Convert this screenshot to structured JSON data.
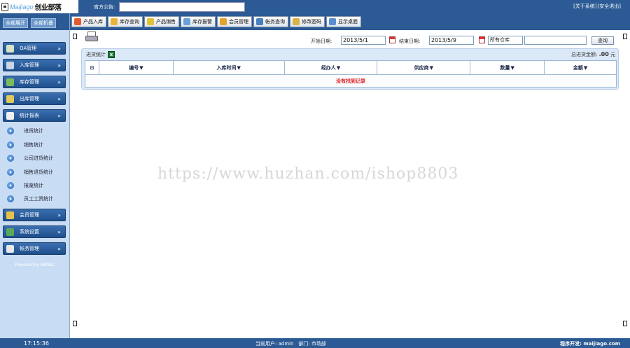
{
  "header": {
    "logo_latin": "Maijiago",
    "logo_cn": "创业部落",
    "notice_label": "官方公告:",
    "links": [
      "[关于系统]",
      "[安全退出]"
    ]
  },
  "toolbar": {
    "buttons": [
      {
        "label": "产品入库",
        "icon": "import-icon",
        "color": "#e25b2d"
      },
      {
        "label": "库存查询",
        "icon": "folder-search-icon",
        "color": "#e8b53a"
      },
      {
        "label": "产品销售",
        "icon": "tag-icon",
        "color": "#e0c23a"
      },
      {
        "label": "库存报警",
        "icon": "speaker-icon",
        "color": "#6aa0d8"
      },
      {
        "label": "会员管理",
        "icon": "member-card-icon",
        "color": "#e3a22a"
      },
      {
        "label": "帐务查询",
        "icon": "account-icon",
        "color": "#4a7fbf"
      },
      {
        "label": "修改密码",
        "icon": "key-icon",
        "color": "#d9b24a"
      },
      {
        "label": "显示桌面",
        "icon": "desktop-icon",
        "color": "#5a8fcf"
      }
    ]
  },
  "sidebar": {
    "expand_all": "全部展开",
    "collapse_all": "全部折叠",
    "menus": [
      {
        "label": "OA管理",
        "icon": "home-icon",
        "color": "#d8e4c6"
      },
      {
        "label": "入库管理",
        "icon": "inbox-icon",
        "color": "#c9d6e6"
      },
      {
        "label": "库存管理",
        "icon": "stock-icon",
        "color": "#7dbb5a"
      },
      {
        "label": "出库管理",
        "icon": "outbox-icon",
        "color": "#e3c85a"
      },
      {
        "label": "统计报表",
        "icon": "report-icon",
        "color": "#f0f0f0"
      }
    ],
    "sub_items": [
      "进货统计",
      "销售统计",
      "公司进货统计",
      "销售退货统计",
      "报废统计",
      "员工工资统计"
    ],
    "bottom_menus": [
      {
        "label": "会员管理",
        "icon": "member-icon",
        "color": "#e6c24a"
      },
      {
        "label": "系统设置",
        "icon": "settings-icon",
        "color": "#5aa85a"
      },
      {
        "label": "帐务管理",
        "icon": "ledger-icon",
        "color": "#e8e8e8"
      }
    ],
    "powered": "Powered by BBNSC"
  },
  "filter": {
    "start_label": "开始日期:",
    "start_value": "2013/5/1",
    "end_label": "结束日期:",
    "end_value": "2013/5/9",
    "warehouse_value": "所有仓库",
    "keyword_value": "",
    "search_label": "查询"
  },
  "panel": {
    "title": "进货统计",
    "total_label": "总进货金额:",
    "total_value": ".00",
    "total_unit": "元",
    "columns": [
      "编号",
      "入库时间",
      "经办人",
      "供应商",
      "数量",
      "金额"
    ],
    "empty_message": "没有找到记录"
  },
  "watermark": "https://www.huzhan.com/ishop8803",
  "status": {
    "time": "17:15:36",
    "user_label": "当前用户:",
    "user_value": "admin",
    "dept_label": "部门:",
    "dept_value": "市场部",
    "developer": "程序开发: maijiago.com"
  }
}
